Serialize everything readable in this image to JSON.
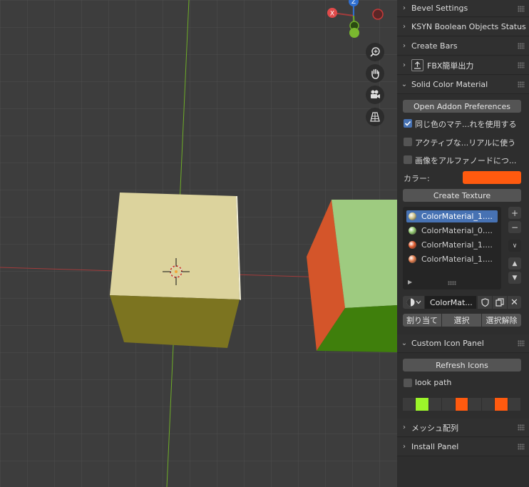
{
  "viewport": {
    "gizmo": {
      "x_label": "X",
      "z_label": "Z"
    },
    "colors": {
      "grid_bg": "#3d3d3d",
      "x_axis": "#a33c3c",
      "y_axis": "#7ab82f",
      "cube1_top": "#dcd39d",
      "cube1_front": "#ccc488",
      "cube1_bottom": "#7c7420",
      "cube2_top": "#9ecb80",
      "cube2_side": "#d4552a",
      "cube2_bottom": "#3f7f0c"
    }
  },
  "nav_buttons": [
    {
      "icon": "zoom-icon"
    },
    {
      "icon": "hand-pan-icon"
    },
    {
      "icon": "camera-icon"
    },
    {
      "icon": "perspective-grid-icon"
    }
  ],
  "panel": {
    "sections": {
      "bevel": "Bevel Settings",
      "ksyn": "KSYN Boolean Objects Status",
      "create_bars": "Create Bars",
      "fbx": "FBX簡単出力",
      "solid_color": "Solid Color Material",
      "custom_icon": "Custom Icon Panel",
      "mesh_array": "メッシュ配列",
      "install": "Install Panel"
    },
    "solid": {
      "open_prefs": "Open Addon Preferences",
      "opt_same_color": "同じ色のマテ...れを使用する",
      "opt_active": "アクティブな...リアルに使う",
      "opt_image_alpha": "画像をアルファノードにつ...",
      "color_label": "カラー:",
      "color_value": "#ff5a0f",
      "create_texture": "Create Texture",
      "materials": [
        {
          "name": "ColorMaterial_1....",
          "color": "#cfc48a",
          "selected": true
        },
        {
          "name": "ColorMaterial_0....",
          "color": "#8dc26a",
          "selected": false
        },
        {
          "name": "ColorMaterial_1....",
          "color": "#e05a2c",
          "selected": false
        },
        {
          "name": "ColorMaterial_1....",
          "color": "#e07a4a",
          "selected": false
        }
      ],
      "material_slot": "ColorMat...",
      "assign": "割り当て",
      "select": "選択",
      "deselect": "選択解除"
    },
    "custom_icon": {
      "refresh": "Refresh Icons",
      "look_path": "look path",
      "swatches": [
        "#3b3b3b",
        "#9cf52a",
        "#3b3b3b",
        "#3b3b3b",
        "#ff5a0f",
        "#3b3b3b",
        "#3b3b3b",
        "#ff5a0f",
        "#3b3b3b"
      ]
    }
  }
}
